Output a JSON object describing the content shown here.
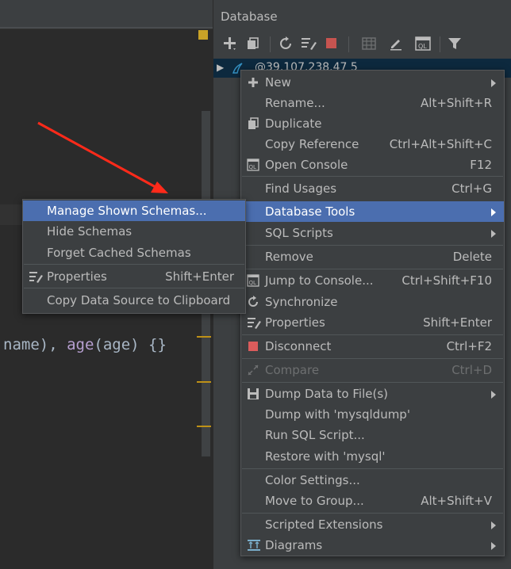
{
  "panel": {
    "title": "Database",
    "toolbar_icons": [
      "add-icon",
      "duplicate-icon",
      "refresh-icon",
      "properties-icon",
      "stop-icon",
      "table-icon",
      "edit-icon",
      "console-icon",
      "filter-icon"
    ]
  },
  "tree": {
    "datasource_label": "@39.107.238.47  5"
  },
  "editor": {
    "code_pre": "name), ",
    "code_fn": "age",
    "code_post": "(age) {}"
  },
  "context_menu": {
    "new": {
      "label": "New"
    },
    "rename": {
      "label": "Rename...",
      "shortcut": "Alt+Shift+R"
    },
    "duplicate": {
      "label": "Duplicate"
    },
    "copy_reference": {
      "label": "Copy Reference",
      "shortcut": "Ctrl+Alt+Shift+C"
    },
    "open_console": {
      "label": "Open Console",
      "shortcut": "F12"
    },
    "find_usages": {
      "label": "Find Usages",
      "shortcut": "Ctrl+G"
    },
    "database_tools": {
      "label": "Database Tools"
    },
    "sql_scripts": {
      "label": "SQL Scripts"
    },
    "remove": {
      "label": "Remove",
      "shortcut": "Delete"
    },
    "jump_to_console": {
      "label": "Jump to Console...",
      "shortcut": "Ctrl+Shift+F10"
    },
    "synchronize": {
      "label": "Synchronize"
    },
    "properties": {
      "label": "Properties",
      "shortcut": "Shift+Enter"
    },
    "disconnect": {
      "label": "Disconnect",
      "shortcut": "Ctrl+F2"
    },
    "compare": {
      "label": "Compare",
      "shortcut": "Ctrl+D"
    },
    "dump_data": {
      "label": "Dump Data to File(s)"
    },
    "dump_mysqldump": {
      "label": "Dump with 'mysqldump'"
    },
    "run_sql_script": {
      "label": "Run SQL Script..."
    },
    "restore_mysql": {
      "label": "Restore with 'mysql'"
    },
    "color_settings": {
      "label": "Color Settings..."
    },
    "move_to_group": {
      "label": "Move to Group...",
      "shortcut": "Alt+Shift+V"
    },
    "scripted_extensions": {
      "label": "Scripted Extensions"
    },
    "diagrams": {
      "label": "Diagrams"
    }
  },
  "submenu": {
    "manage_shown_schemas": {
      "label": "Manage Shown Schemas..."
    },
    "hide_schemas": {
      "label": "Hide Schemas"
    },
    "forget_cached_schemas": {
      "label": "Forget Cached Schemas"
    },
    "properties": {
      "label": "Properties",
      "shortcut": "Shift+Enter"
    },
    "copy_data_source": {
      "label": "Copy Data Source to Clipboard"
    }
  },
  "colors": {
    "selection": "#4b6eaf",
    "menu_bg": "#3c3f41",
    "editor_bg": "#2b2b2b",
    "annotation_arrow": "#ff2a1a",
    "disconnect_red": "#db5c5c"
  }
}
